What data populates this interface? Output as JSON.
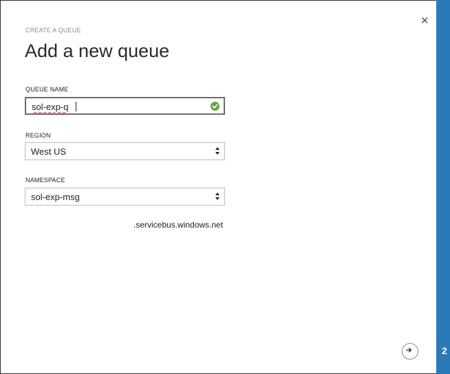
{
  "dialog": {
    "eyebrow": "CREATE A QUEUE",
    "title": "Add a new queue",
    "close_icon": "close-icon",
    "step_number": "2"
  },
  "form": {
    "queue_name_label": "QUEUE NAME",
    "queue_name_value": "sol-exp-q",
    "queue_name_status_icon": "check-circle-icon",
    "region_label": "REGION",
    "region_value": "West US",
    "namespace_label": "NAMESPACE",
    "namespace_value": "sol-exp-msg",
    "namespace_suffix": ".servicebus.windows.net"
  },
  "footer": {
    "next_icon": "arrow-right-icon"
  },
  "colors": {
    "accent": "#2b7ab8",
    "valid": "#6aa536",
    "spellcheck": "#d23b3b"
  }
}
